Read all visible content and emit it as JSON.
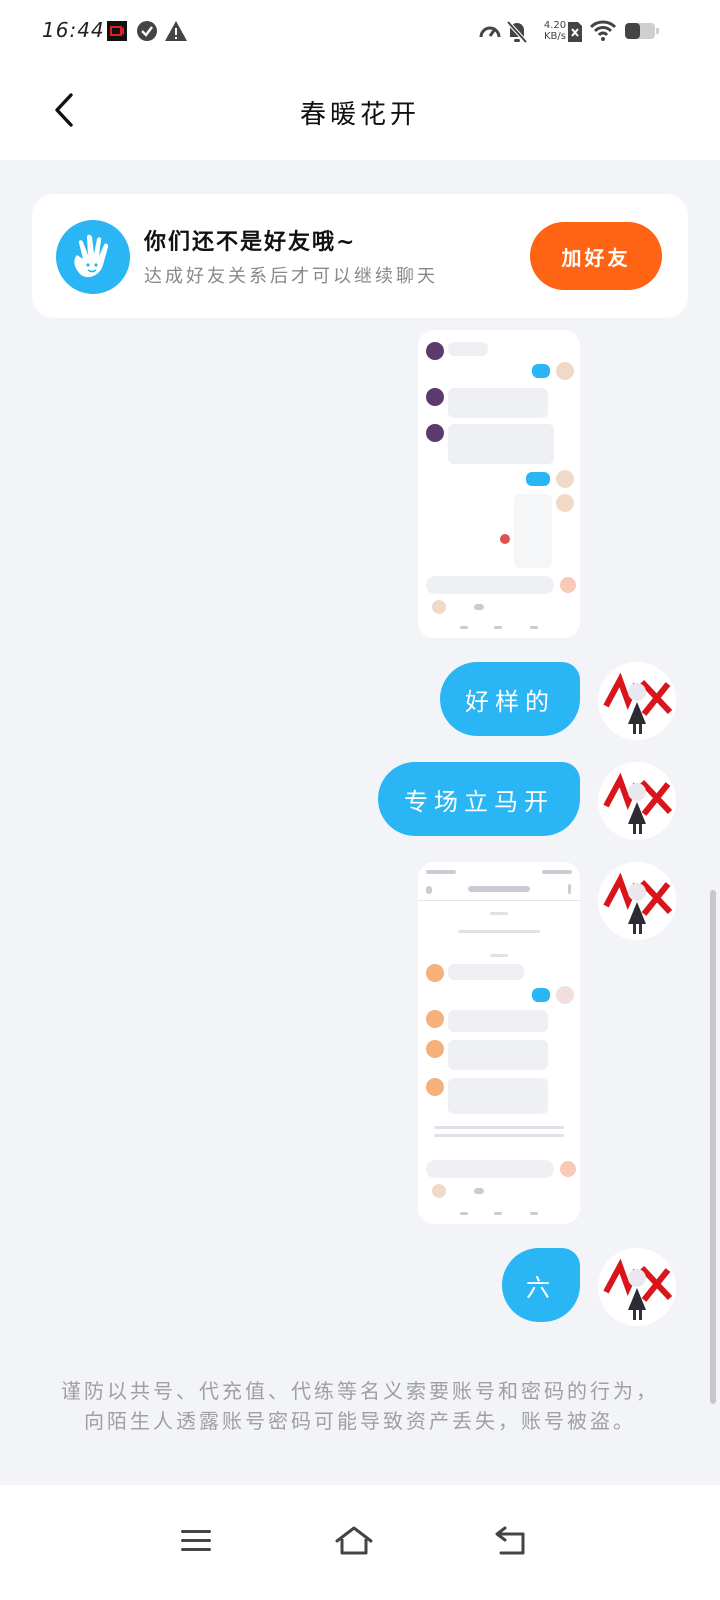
{
  "status_bar": {
    "time": "16:44",
    "net_speed_value": "4.20",
    "net_speed_unit": "KB/s",
    "icons": [
      "screen-record-icon",
      "check-circle-icon",
      "warning-icon",
      "speedometer-icon",
      "bell-off-icon",
      "sim-off-icon",
      "wifi-icon",
      "battery-icon"
    ]
  },
  "header": {
    "title": "春暖花开",
    "back_icon": "chevron-left-icon"
  },
  "notice": {
    "title": "你们还不是好友哦~",
    "subtitle": "达成好友关系后才可以继续聊天",
    "button_label": "加好友",
    "icon": "hand-wave-icon"
  },
  "messages": [
    {
      "type": "image",
      "description_icon": "screenshot-thumbnail",
      "side": "right"
    },
    {
      "type": "text",
      "text": "好样的",
      "side": "right"
    },
    {
      "type": "text",
      "text": "专场立马开",
      "side": "right"
    },
    {
      "type": "image",
      "description_icon": "screenshot-thumbnail",
      "side": "right"
    },
    {
      "type": "text",
      "text": "六",
      "side": "right"
    }
  ],
  "warning": {
    "text": "谨防以共号、代充值、代练等名义索要账号和密码的行为，向陌生人透露账号密码可能导致资产丢失，账号被盗。"
  },
  "nav": {
    "icons": [
      "menu-icon",
      "home-icon",
      "back-icon"
    ]
  },
  "colors": {
    "accent_blue": "#2ab6f4",
    "add_friend_orange": "#ff6314",
    "background": "#f3f4f8"
  }
}
